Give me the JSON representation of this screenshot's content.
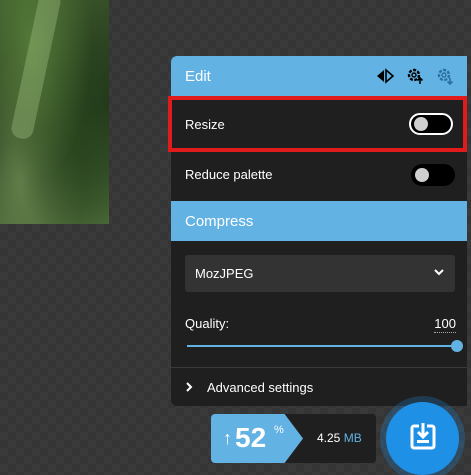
{
  "edit": {
    "title": "Edit",
    "icons": [
      "rotate-flip-icon",
      "settings-upload-icon",
      "settings-icon"
    ]
  },
  "resize": {
    "label": "Resize",
    "enabled": false
  },
  "reduce_palette": {
    "label": "Reduce palette",
    "enabled": false
  },
  "compress": {
    "title": "Compress",
    "codec": "MozJPEG",
    "quality_label": "Quality:",
    "quality_value": "100",
    "quality_level": 100,
    "advanced_label": "Advanced settings"
  },
  "result": {
    "arrow": "↑",
    "percent": "52",
    "percent_symbol": "%",
    "size_value": "4.25",
    "size_unit": "MB"
  },
  "colors": {
    "accent": "#62b2e4",
    "download": "#1e90e6",
    "panel": "#1f1f1f",
    "highlight": "#e01b1b"
  }
}
